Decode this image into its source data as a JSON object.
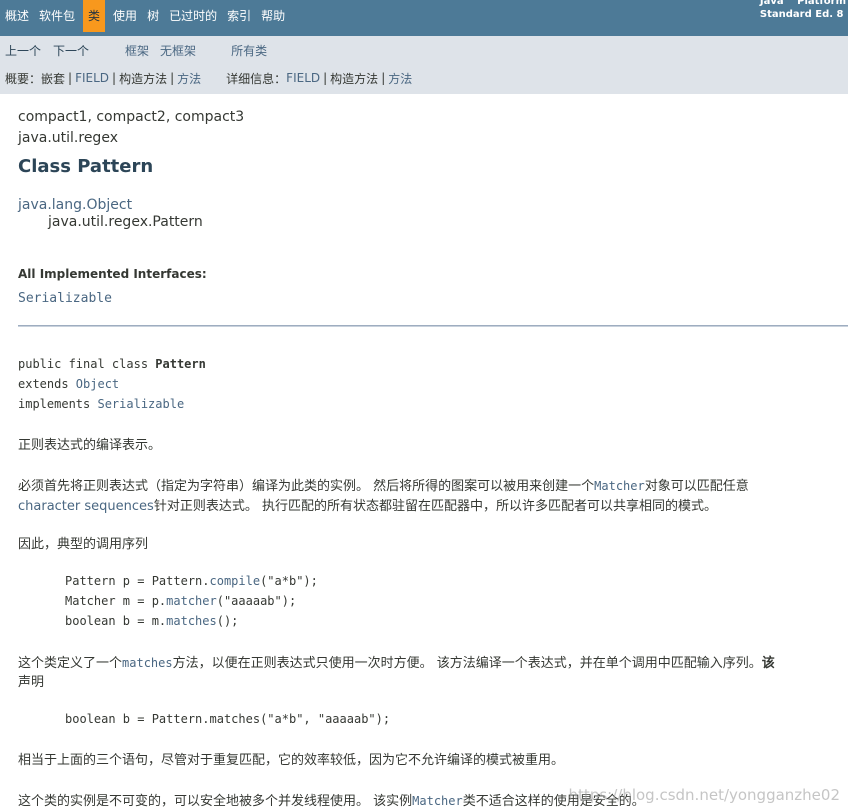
{
  "topnav": {
    "items": [
      "概述",
      "软件包",
      "类",
      "使用",
      "树",
      "已过时的",
      "索引",
      "帮助"
    ],
    "active_index": 2,
    "platform_line1": "Java™ Platform",
    "platform_line2": "Standard Ed. 8"
  },
  "subnav": {
    "prev": "上一个",
    "next": "下一个",
    "frames": "框架",
    "no_frames": "无框架",
    "all_classes": "所有类",
    "summary_label": "概要：",
    "summary_nested": "嵌套",
    "summary_field": "FIELD",
    "summary_constr": "构造方法",
    "summary_method": "方法",
    "detail_label": "详细信息：",
    "detail_field": "FIELD",
    "detail_constr": "构造方法",
    "detail_method": "方法",
    "sep": "|"
  },
  "header": {
    "profiles": "compact1, compact2, compact3",
    "package": "java.util.regex",
    "title": "Class Pattern"
  },
  "inheritance": {
    "parent": "java.lang.Object",
    "child": "java.util.regex.Pattern"
  },
  "interfaces": {
    "label": "All Implemented Interfaces:",
    "item": "Serializable"
  },
  "signature": {
    "line1_prefix": "public final class ",
    "line1_name": "Pattern",
    "line2_kw": "extends ",
    "line2_link": "Object",
    "line3_kw": "implements ",
    "line3_link": "Serializable"
  },
  "description": {
    "p1": "正则表达式的编译表示。",
    "p2_a": "必须首先将正则表达式（指定为字符串）编译为此类的实例。 然后将所得的图案可以被用来创建一个",
    "p2_link": "Matcher",
    "p2_b": "对象可以匹配任意",
    "p2_link2": "character sequences",
    "p2_c": "针对正则表达式。 执行匹配的所有状态都驻留在匹配器中，所以许多匹配者可以共享相同的模式。",
    "p3": "因此，典型的调用序列",
    "code1_a": "Pattern p = Pattern.",
    "code1_m": "compile",
    "code1_b": "(\"a*b\");",
    "code2_a": "Matcher m = p.",
    "code2_m": "matcher",
    "code2_b": "(\"aaaaab\");",
    "code3_a": "boolean b = m.",
    "code3_m": "matches",
    "code3_b": "();",
    "p4_a": "这个类定义了一个",
    "p4_link": "matches",
    "p4_b": "方法，以便在正则表达式只使用一次时方便。 该方法编译一个表达式，并在单个调用中匹配输入序列。",
    "p4_bold": "该",
    "p4_c": "声明",
    "code4": "boolean b = Pattern.matches(\"a*b\", \"aaaaab\");",
    "p5": "相当于上面的三个语句，尽管对于重复匹配，它的效率较低，因为它不允许编译的模式被重用。",
    "p6_a": "这个类的实例是不可变的，可以安全地被多个并发线程使用。 该实例",
    "p6_link": "Matcher",
    "p6_b": "类不适合这样的使用是安全的。"
  },
  "watermark": "https://blog.csdn.net/yongganzhe02"
}
